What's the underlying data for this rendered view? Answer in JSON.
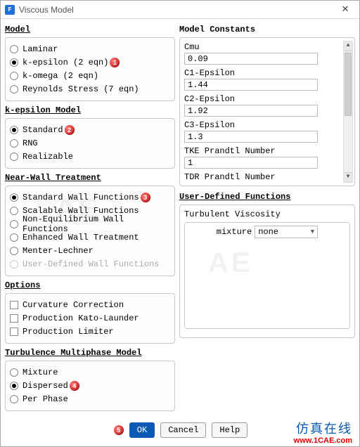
{
  "window": {
    "title": "Viscous Model",
    "icon_letter": "F"
  },
  "model": {
    "heading": "Model",
    "options": [
      {
        "label": "Laminar",
        "checked": false
      },
      {
        "label": "k-epsilon (2 eqn)",
        "checked": true,
        "marker": "1"
      },
      {
        "label": "k-omega (2 eqn)",
        "checked": false
      },
      {
        "label": "Reynolds Stress (7 eqn)",
        "checked": false
      }
    ]
  },
  "kepsilon": {
    "heading": "k-epsilon Model",
    "options": [
      {
        "label": "Standard",
        "checked": true,
        "marker": "2"
      },
      {
        "label": "RNG",
        "checked": false
      },
      {
        "label": "Realizable",
        "checked": false
      }
    ]
  },
  "nearwall": {
    "heading": "Near-Wall Treatment",
    "options": [
      {
        "label": "Standard Wall Functions",
        "checked": true,
        "marker": "3"
      },
      {
        "label": "Scalable Wall Functions",
        "checked": false
      },
      {
        "label": "Non-Equilibrium Wall Functions",
        "checked": false
      },
      {
        "label": "Enhanced Wall Treatment",
        "checked": false
      },
      {
        "label": "Menter-Lechner",
        "checked": false
      },
      {
        "label": "User-Defined Wall Functions",
        "checked": false,
        "disabled": true
      }
    ]
  },
  "options": {
    "heading": "Options",
    "items": [
      {
        "label": "Curvature Correction",
        "checked": false
      },
      {
        "label": "Production Kato-Launder",
        "checked": false
      },
      {
        "label": "Production Limiter",
        "checked": false
      }
    ]
  },
  "multiphase": {
    "heading": "Turbulence Multiphase Model",
    "options": [
      {
        "label": "Mixture",
        "checked": false
      },
      {
        "label": "Dispersed",
        "checked": true,
        "marker": "4"
      },
      {
        "label": "Per Phase",
        "checked": false
      }
    ]
  },
  "constants": {
    "heading": "Model Constants",
    "items": [
      {
        "label": "Cmu",
        "value": "0.09"
      },
      {
        "label": "C1-Epsilon",
        "value": "1.44"
      },
      {
        "label": "C2-Epsilon",
        "value": "1.92"
      },
      {
        "label": "C3-Epsilon",
        "value": "1.3"
      },
      {
        "label": "TKE Prandtl Number",
        "value": "1"
      },
      {
        "label": "TDR Prandtl Number",
        "value": ""
      }
    ]
  },
  "udf": {
    "heading": "User-Defined Functions",
    "sublabel": "Turbulent Viscosity",
    "row_label": "mixture",
    "select_value": "none"
  },
  "footer": {
    "ok": "OK",
    "ok_marker": "5",
    "cancel": "Cancel",
    "help": "Help"
  },
  "watermark": {
    "top": "仿真在线",
    "bottom": "www.1CAE.com"
  }
}
